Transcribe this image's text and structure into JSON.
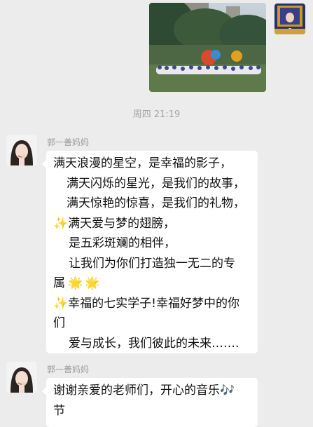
{
  "chat": {
    "timestamp": "周四 21:19",
    "messages": [
      {
        "sender": "郭一善妈妈",
        "lines": [
          "满天浪漫的星空，是幸福的影子，",
          "满天闪烁的星光，是我们的故事，",
          "满天惊艳的惊喜，是我们的礼物，",
          "满天爱与梦的翅膀，",
          "是五彩斑斓的相伴，",
          "让我们为你们打造独一无二的专",
          "属",
          "幸福的七实学子!幸福好梦中的你",
          "们",
          "爱与成长，我们彼此的未来……."
        ],
        "emoji": {
          "sparkle": "✨",
          "glowing_star": "🌟"
        }
      },
      {
        "sender": "郭一善妈妈",
        "lines": [
          "谢谢亲爱的老师们，开心的音乐",
          "节"
        ],
        "emoji": {
          "music": "🎶"
        }
      }
    ]
  }
}
